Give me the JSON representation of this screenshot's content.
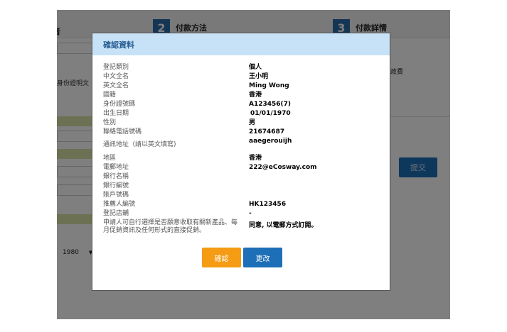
{
  "background": {
    "step1_stub": "者",
    "step2": {
      "number": "2",
      "label": "付款方法"
    },
    "step3": {
      "number": "3",
      "label": "付款詳情"
    },
    "id_stub": "身份證明文",
    "fee_stub": "行政費",
    "submit_label": "提交",
    "year_select": "1980"
  },
  "modal": {
    "title": "確認資料",
    "rows": [
      {
        "key": "登記類別",
        "value": "個人"
      },
      {
        "key": "中文全名",
        "value": "王小明"
      },
      {
        "key": "英文全名",
        "value": "Ming Wong"
      },
      {
        "key": "國籍",
        "value": "香港"
      },
      {
        "key": "身份證號碼",
        "value": "A123456(7)"
      },
      {
        "key": "出生日期",
        "value": "01/01/1970"
      },
      {
        "key": "性別",
        "value": "男"
      },
      {
        "key": "聯絡電話號碼",
        "value": "21674687"
      },
      {
        "key": "通訊地址（請以英文填寫)",
        "value": "aaegerouijh"
      },
      {
        "key": "地區",
        "value": "香港"
      },
      {
        "key": "電郵地址",
        "value": "222@eCosway.com"
      },
      {
        "key": "銀行名稱",
        "value": ""
      },
      {
        "key": "銀行編號",
        "value": ""
      },
      {
        "key": "賬戶號碼",
        "value": ""
      },
      {
        "key": "推薦人編號",
        "value": "HK123456"
      },
      {
        "key": "登記店舖",
        "value": "-"
      },
      {
        "key": "申請人可自行選擇是否願意收取有關新產品、每月促銷資訊及任何形式的直接促銷。",
        "value": "同意, 以電郵方式訂閱。"
      }
    ],
    "confirm_label": "確認",
    "edit_label": "更改"
  },
  "colors": {
    "header_bg": "#c7e2f7",
    "header_text": "#2a5f93",
    "confirm_button": "#f59b14",
    "edit_button": "#1d6fb8"
  }
}
